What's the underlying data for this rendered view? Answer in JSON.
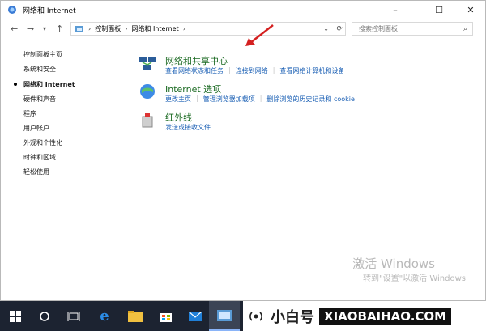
{
  "window": {
    "title": "网络和 Internet",
    "controls": {
      "minimize": "–",
      "maximize": "☐",
      "close": "✕"
    }
  },
  "address": {
    "crumbs": [
      "控制面板",
      "网络和 Internet"
    ],
    "refresh_icon": "refresh-icon",
    "search_placeholder": "搜索控制面板"
  },
  "sidebar": {
    "items": [
      {
        "label": "控制面板主页"
      },
      {
        "label": "系统和安全"
      },
      {
        "label": "网络和 Internet",
        "current": true
      },
      {
        "label": "硬件和声音"
      },
      {
        "label": "程序"
      },
      {
        "label": "用户帐户"
      },
      {
        "label": "外观和个性化"
      },
      {
        "label": "时钟和区域"
      },
      {
        "label": "轻松使用"
      }
    ]
  },
  "categories": [
    {
      "title": "网络和共享中心",
      "links": [
        "查看网络状态和任务",
        "连接到网络",
        "查看网络计算机和设备"
      ]
    },
    {
      "title": "Internet 选项",
      "links": [
        "更改主页",
        "管理浏览器加载项",
        "删除浏览的历史记录和 cookie"
      ]
    },
    {
      "title": "红外线",
      "links": [
        "发送或接收文件"
      ]
    }
  ],
  "activation": {
    "line1": "激活 Windows",
    "line2": "转到\"设置\"以激活 Windows"
  },
  "taskbar": {
    "items": [
      "start-icon",
      "cortana-icon",
      "task-view-icon",
      "edge-icon",
      "file-explorer-icon",
      "store-icon",
      "mail-icon",
      "control-panel-icon"
    ]
  },
  "brand": {
    "cn": "小白号",
    "en": "XIAOBAIHAO.COM"
  },
  "colors": {
    "link": "#1a5fb4",
    "category": "#1b6a22",
    "taskbar": "#1c2331"
  }
}
